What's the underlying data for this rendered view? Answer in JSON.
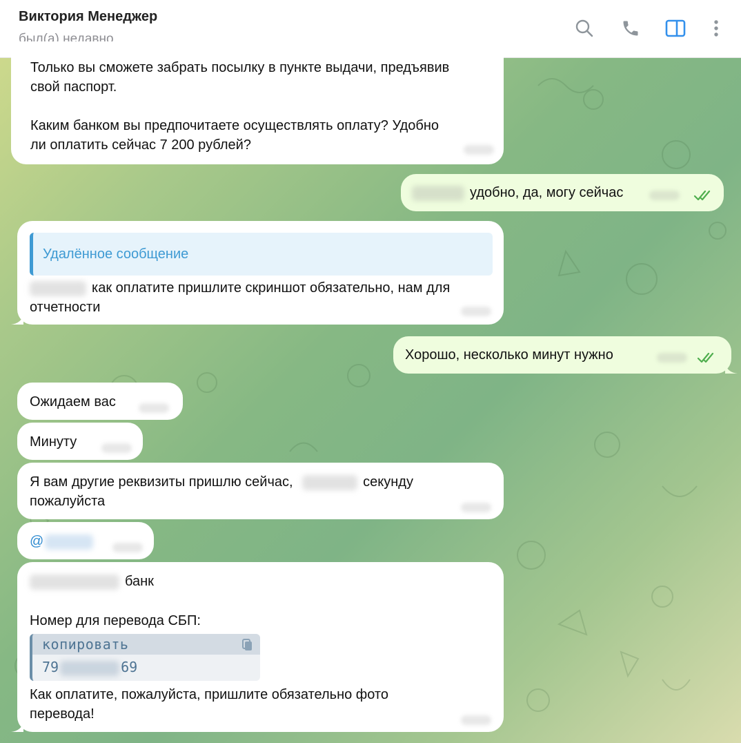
{
  "header": {
    "contact_name": "Виктория Менеджер",
    "status": "был(а) недавно",
    "icons": [
      "search-icon",
      "phone-icon",
      "sidebar-toggle-icon",
      "more-vertical-icon"
    ],
    "accent_color": "#3390ec"
  },
  "messages": [
    {
      "direction": "in",
      "text": "Только вы сможете забрать посылку в пункте выдачи, предъявив\nсвой паспорт.\n\nКаким банком вы предпочитаете осуществлять оплату? Удобно\nли оплатить сейчас 7 200 рублей?"
    },
    {
      "direction": "out",
      "text": "удобно, да, могу сейчас"
    },
    {
      "direction": "in",
      "reply_label": "Удалённое сообщение",
      "text": "как оплатите пришлите скриншот обязательно, нам для\nотчетности"
    },
    {
      "direction": "out",
      "text": "Хорошо, несколько минут нужно"
    },
    {
      "direction": "in",
      "text": "Ожидаем вас"
    },
    {
      "direction": "in",
      "text": "Минуту"
    },
    {
      "direction": "in",
      "text_a": "Я вам другие реквизиты пришлю сейчас,",
      "text_b": "секунду\nпожалуйста"
    },
    {
      "direction": "in",
      "mention_prefix": "@"
    },
    {
      "direction": "in",
      "bank_suffix": "банк",
      "sbp_label": "Номер для перевода СБП:",
      "copy_label": "копировать",
      "phone_start": "79",
      "phone_end": "69",
      "footer": "Как оплатите, пожалуйста, пришлите обязательно фото\nперевода!"
    }
  ],
  "colors": {
    "incoming_bubble": "#ffffff",
    "outgoing_bubble": "#effdde",
    "read_checks": "#4fae4e",
    "link": "#3e9ad3"
  }
}
